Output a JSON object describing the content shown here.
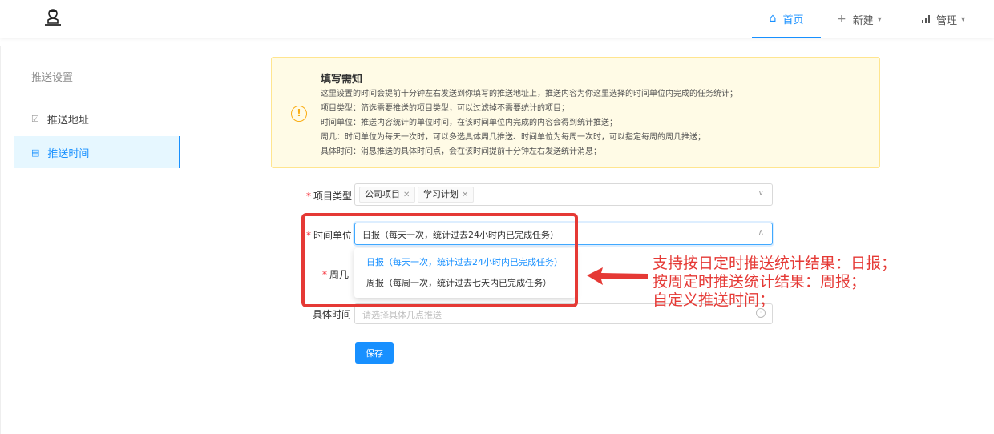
{
  "header": {
    "nav": [
      {
        "label": "首页",
        "icon": "home-icon"
      },
      {
        "label": "新建",
        "icon": "plus-icon"
      },
      {
        "label": "管理",
        "icon": "bar-chart-icon"
      }
    ]
  },
  "sidebar": {
    "title": "推送设置",
    "items": [
      {
        "label": "推送地址",
        "icon": "checkbox-icon"
      },
      {
        "label": "推送时间",
        "icon": "calendar-icon",
        "active": true
      }
    ]
  },
  "notice": {
    "title": "填写需知",
    "lines": [
      "这里设置的时间会提前十分钟左右发送到你填写的推送地址上，推送内容为你这里选择的时间单位内完成的任务统计；",
      "项目类型：筛选需要推送的项目类型，可以过滤掉不需要统计的项目；",
      "时间单位：推送内容统计的单位时间，在该时间单位内完成的内容会得到统计推送；",
      "周几：时间单位为每天一次时，可以多选具体周几推送、时间单位为每周一次时，可以指定每周的周几推送；",
      "具体时间：消息推送的具体时间点，会在该时间提前十分钟左右发送统计消息；"
    ]
  },
  "form": {
    "project_type": {
      "label": "项目类型",
      "tags": [
        "公司项目",
        "学习计划"
      ]
    },
    "time_unit": {
      "label": "时间单位",
      "value": "日报（每天一次，统计过去24小时内已完成任务）",
      "options": [
        "日报（每天一次，统计过去24小时内已完成任务）",
        "周报（每周一次，统计过去七天内已完成任务）"
      ]
    },
    "weekday": {
      "label": "周几"
    },
    "specific_time": {
      "label": "具体时间",
      "placeholder": "请选择具体几点推送"
    },
    "save_label": "保存"
  },
  "annotation": {
    "lines": [
      "支持按日定时推送统计结果：日报；",
      "按周定时推送统计结果：周报；",
      "自定义推送时间；"
    ]
  },
  "colors": {
    "primary": "#1890ff",
    "annotation": "#e53935",
    "notice_bg": "#fffbe6"
  }
}
